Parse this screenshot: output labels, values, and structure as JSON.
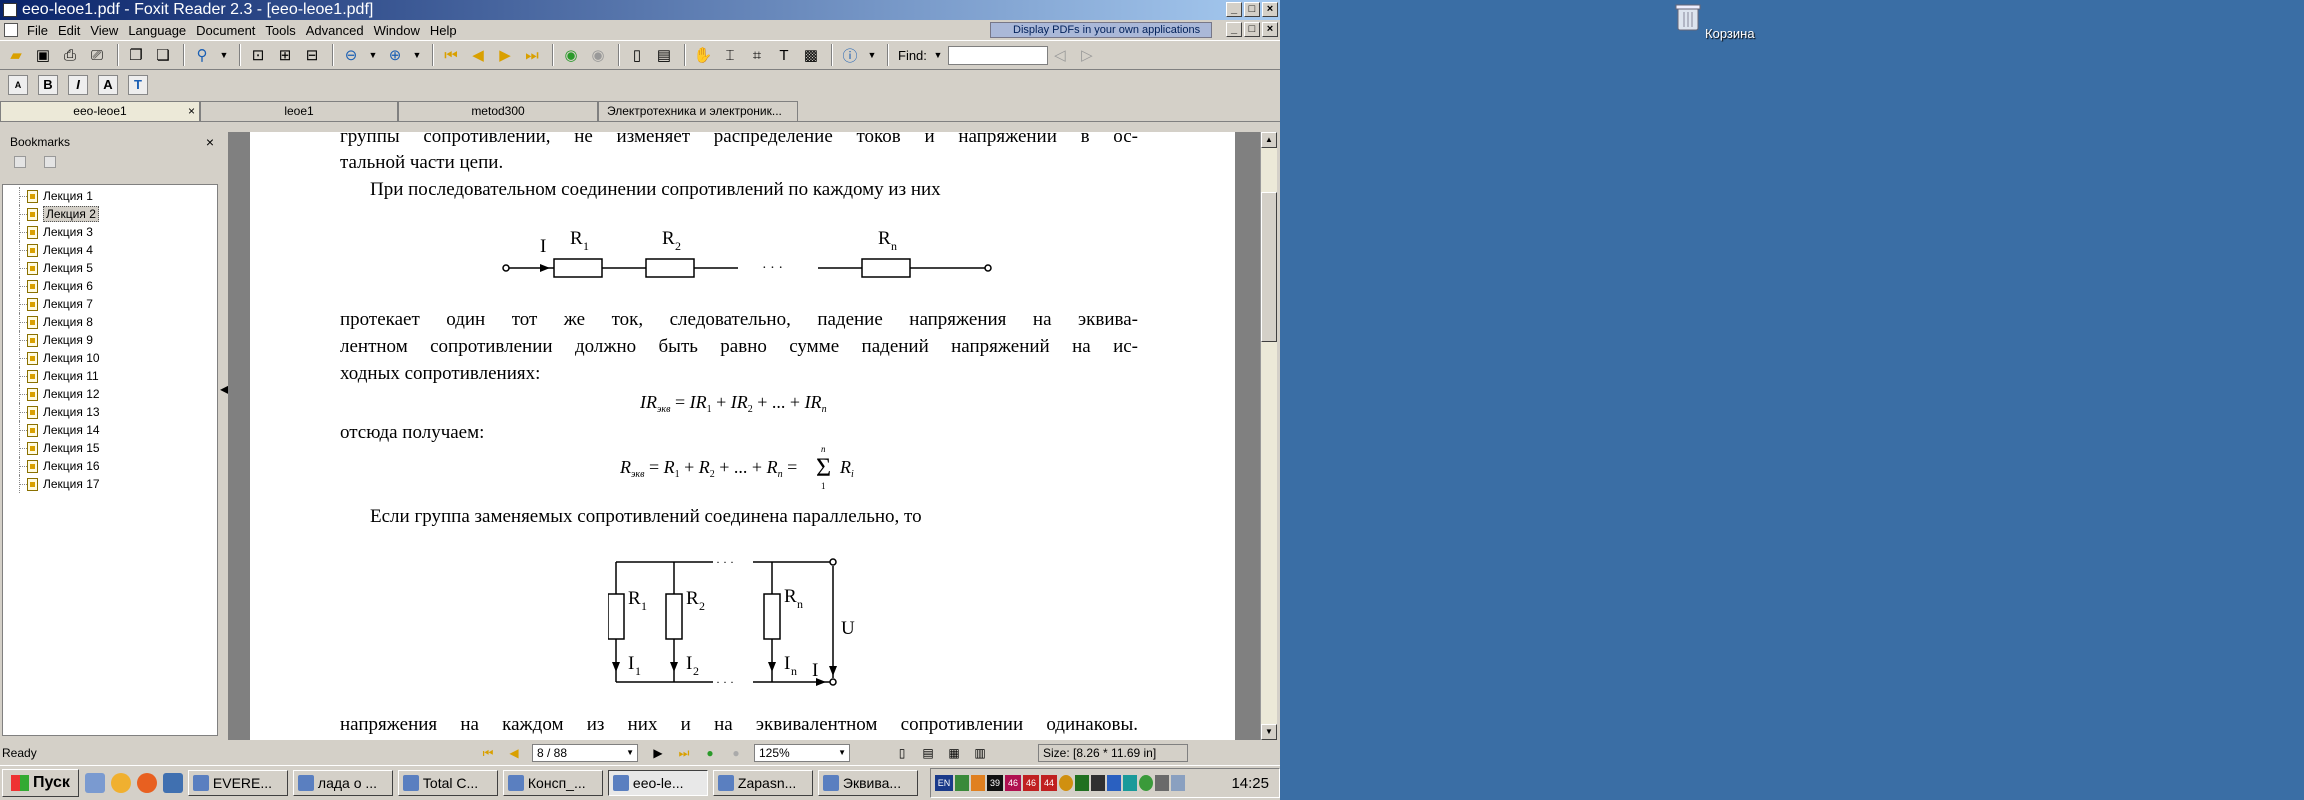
{
  "window": {
    "title": "eeo-leoe1.pdf - Foxit Reader 2.3 - [eeo-leoe1.pdf]",
    "promo": "Display PDFs in your own applications"
  },
  "menu": [
    "File",
    "Edit",
    "View",
    "Language",
    "Document",
    "Tools",
    "Advanced",
    "Window",
    "Help"
  ],
  "toolbar": {
    "find_label": "Find:",
    "find_value": ""
  },
  "tabs": [
    "eeo-leoe1",
    "leoe1",
    "metod300",
    "Электротехника и электроник..."
  ],
  "bookmarks": {
    "title": "Bookmarks",
    "close": "×",
    "items": [
      "Лекция 1",
      "Лекция 2",
      "Лекция 3",
      "Лекция 4",
      "Лекция 5",
      "Лекция 6",
      "Лекция 7",
      "Лекция 8",
      "Лекция 9",
      "Лекция 10",
      "Лекция 11",
      "Лекция 12",
      "Лекция 13",
      "Лекция 14",
      "Лекция 15",
      "Лекция 16",
      "Лекция 17"
    ],
    "selected_index": 1
  },
  "document": {
    "line1": "группы сопротивлений,  не  изменяет распределение токов и напряжений в ос-",
    "line2": "тальной части цепи.",
    "line3": "При последовательном соединении сопротивлений по каждому из них",
    "series": {
      "current": "I",
      "r1": "R",
      "r1_sub": "1",
      "r2": "R",
      "r2_sub": "2",
      "rn": "R",
      "rn_sub": "n",
      "dots": "· · ·"
    },
    "line4": "протекает один тот же ток,  следовательно, падение напряжения на эквива-",
    "line5": "лентном сопротивлении  должно быть равно сумме падений напряжений на ис-",
    "line6": "ходных сопротивлениях:",
    "formula1": "IRэкв = IR1 + IR2 + ... + IRn",
    "line7": "отсюда получаем:",
    "formula2": "Rэкв = R1 + R2 + ... + Rn = Σ Ri",
    "line8": "Если группа заменяемых сопротивлений соединена параллельно, то",
    "parallel": {
      "r1": "R",
      "r1_sub": "1",
      "r2": "R",
      "r2_sub": "2",
      "rn": "R",
      "rn_sub": "n",
      "i1": "I",
      "i1_sub": "1",
      "i2": "I",
      "i2_sub": "2",
      "in": "I",
      "in_sub": "n",
      "i": "I",
      "u": "U",
      "dots": "· · ·"
    },
    "line9": "напряжения на каждом из них и на эквивалентном сопротивлении  одинаковы."
  },
  "status": {
    "ready": "Ready",
    "page": "8 / 88",
    "zoom": "125%",
    "size": "Size: [8.26 * 11.69 in]"
  },
  "taskbar": {
    "start": "Пуск",
    "tasks": [
      "EVERE...",
      "лада о ...",
      "Total C...",
      "Консп_...",
      "eeo-le...",
      "Zapasn...",
      "Эквива..."
    ],
    "active_index": 4,
    "tray_lang": "EN",
    "tray_nums": [
      "39",
      "46",
      "46",
      "44"
    ],
    "clock": "14:25"
  },
  "desktop": {
    "icon_label": "Корзина"
  }
}
